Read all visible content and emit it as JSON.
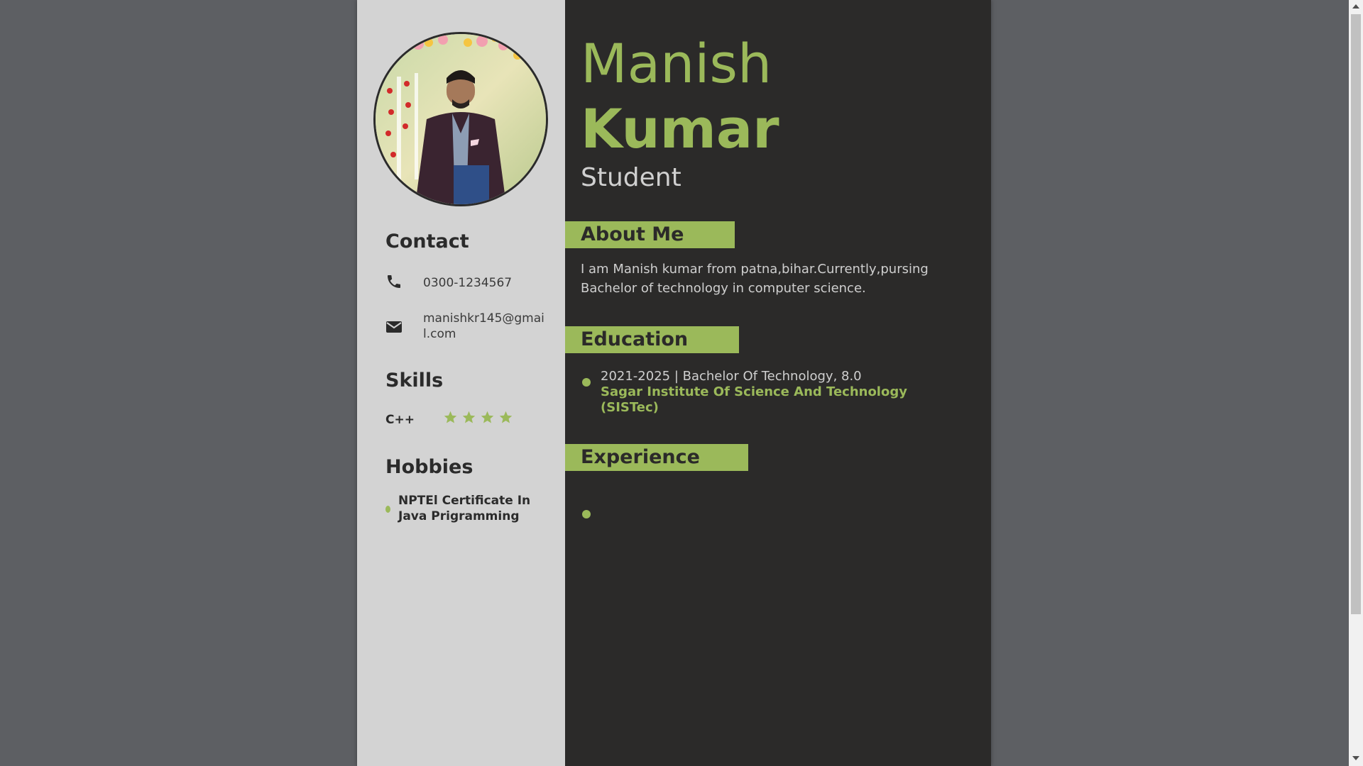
{
  "colors": {
    "accent": "#9bb95a",
    "sidebar_bg": "#d3d3d3",
    "main_bg": "#2b2a29",
    "backdrop": "#5d5f63"
  },
  "profile": {
    "photo_alt": "profile-photo"
  },
  "sidebar": {
    "contact_title": "Contact",
    "phone": "0300-1234567",
    "phone_icon": "phone-icon",
    "email": "manishkr145@gmail.com",
    "email_icon": "envelope-icon",
    "skills_title": "Skills",
    "skills": [
      {
        "name": "C++",
        "rating": 4
      }
    ],
    "hobbies_title": "Hobbies",
    "hobbies": [
      "NPTEl Certificate In Java Prigramming"
    ]
  },
  "main": {
    "first_name": "Manish",
    "last_name": "Kumar",
    "role": "Student",
    "about_title": "About Me",
    "about_text": "I am Manish kumar from patna,bihar.Currently,pursing Bachelor of technology in computer science.",
    "education_title": "Education",
    "education": [
      {
        "line": "2021-2025 | Bachelor Of Technology, 8.0",
        "institution": "Sagar Institute Of Science And Technology (SISTec)"
      }
    ],
    "experience_title": "Experience",
    "experience": [
      ""
    ]
  }
}
